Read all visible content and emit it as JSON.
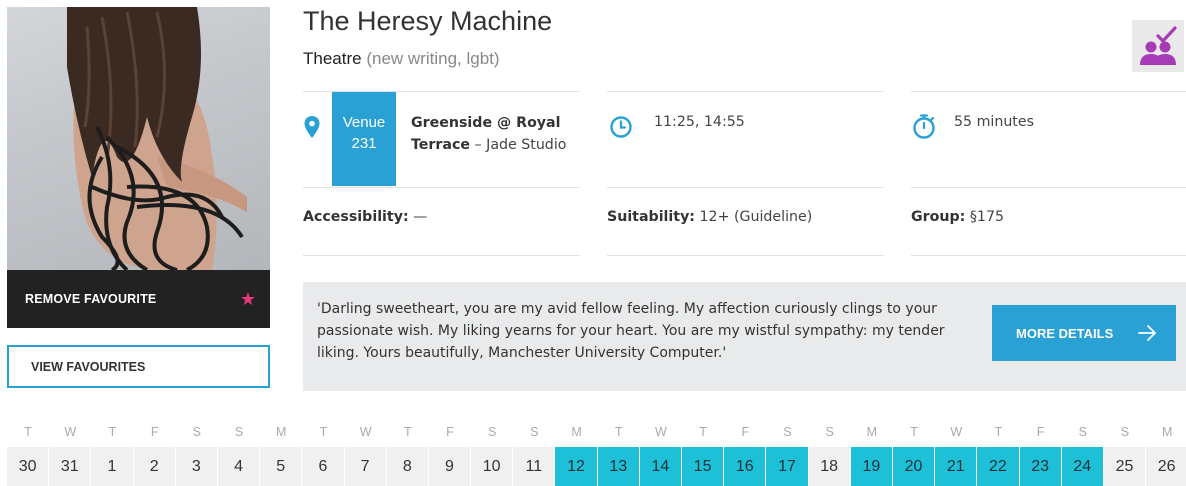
{
  "show": {
    "title": "The Heresy Machine",
    "genre": "Theatre",
    "tags": "(new writing, lgbt)"
  },
  "favourites": {
    "remove_label": "REMOVE FAVOURITE",
    "view_label": "VIEW FAVOURITES"
  },
  "venue": {
    "label": "Venue",
    "number": "231",
    "name": "Greenside @ Royal Terrace",
    "room": " – Jade Studio"
  },
  "times": "11:25, 14:55",
  "duration": "55 minutes",
  "accessibility": {
    "label": "Accessibility:",
    "value": " —"
  },
  "suitability": {
    "label": "Suitability:",
    "value": " 12+ (Guideline)"
  },
  "group": {
    "label": "Group:",
    "value": " §175"
  },
  "quote": "'Darling sweetheart, you are my avid fellow feeling. My affection curiously clings to your passionate wish. My liking yearns for your heart. You are my wistful sympathy: my tender liking. Yours beautifully, Manchester University Computer.'",
  "more_details_label": "MORE DETAILS",
  "colors": {
    "accent": "#2aa1d4",
    "calendar_active": "#1ec0d7",
    "favourite_star": "#e8397d",
    "group_icon": "#a63bb5"
  },
  "icons": {
    "venue": "map-pin-icon",
    "times": "clock-icon",
    "duration": "stopwatch-icon",
    "favourite": "star-icon",
    "more": "arrow-right-icon",
    "group": "group-check-icon"
  },
  "calendar": {
    "weekdays": [
      "T",
      "W",
      "T",
      "F",
      "S",
      "S",
      "M",
      "T",
      "W",
      "T",
      "F",
      "S",
      "S",
      "M",
      "T",
      "W",
      "T",
      "F",
      "S",
      "S",
      "M",
      "T",
      "W",
      "T",
      "F",
      "S",
      "S",
      "M"
    ],
    "dates": [
      {
        "day": "30",
        "performing": false
      },
      {
        "day": "31",
        "performing": false
      },
      {
        "day": "1",
        "performing": false
      },
      {
        "day": "2",
        "performing": false
      },
      {
        "day": "3",
        "performing": false
      },
      {
        "day": "4",
        "performing": false
      },
      {
        "day": "5",
        "performing": false
      },
      {
        "day": "6",
        "performing": false
      },
      {
        "day": "7",
        "performing": false
      },
      {
        "day": "8",
        "performing": false
      },
      {
        "day": "9",
        "performing": false
      },
      {
        "day": "10",
        "performing": false
      },
      {
        "day": "11",
        "performing": false
      },
      {
        "day": "12",
        "performing": true
      },
      {
        "day": "13",
        "performing": true
      },
      {
        "day": "14",
        "performing": true
      },
      {
        "day": "15",
        "performing": true
      },
      {
        "day": "16",
        "performing": true
      },
      {
        "day": "17",
        "performing": true
      },
      {
        "day": "18",
        "performing": false
      },
      {
        "day": "19",
        "performing": true
      },
      {
        "day": "20",
        "performing": true
      },
      {
        "day": "21",
        "performing": true
      },
      {
        "day": "22",
        "performing": true
      },
      {
        "day": "23",
        "performing": true
      },
      {
        "day": "24",
        "performing": true
      },
      {
        "day": "25",
        "performing": false
      },
      {
        "day": "26",
        "performing": false
      }
    ]
  }
}
